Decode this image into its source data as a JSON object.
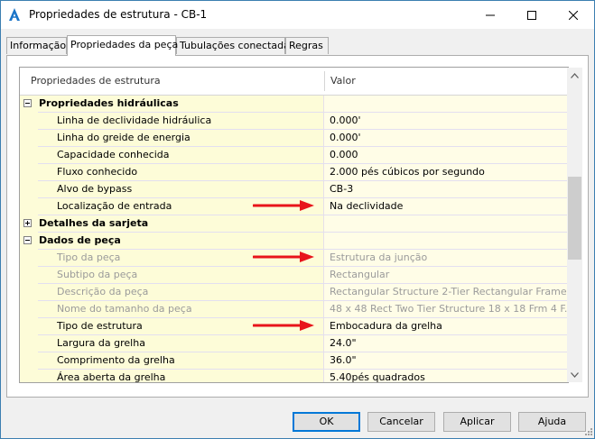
{
  "window": {
    "title": "Propriedades de estrutura - CB-1",
    "controls": {
      "minimize": "minimize",
      "maximize": "maximize",
      "close": "close"
    }
  },
  "tabs": [
    {
      "label": "Informação",
      "active": false
    },
    {
      "label": "Propriedades da peça",
      "active": true
    },
    {
      "label": "Tubulações conectadas",
      "active": false
    },
    {
      "label": "Regras",
      "active": false
    }
  ],
  "grid": {
    "header": {
      "property": "Propriedades de estrutura",
      "value": "Valor"
    },
    "rows": [
      {
        "type": "category",
        "name": "Propriedades hidráulicas",
        "expanded": true
      },
      {
        "type": "prop",
        "name": "Linha de declividade hidráulica",
        "value": "0.000'"
      },
      {
        "type": "prop",
        "name": "Linha do greide de energia",
        "value": "0.000'"
      },
      {
        "type": "prop",
        "name": "Capacidade conhecida",
        "value": "0.000"
      },
      {
        "type": "prop",
        "name": "Fluxo conhecido",
        "value": "2.000 pés cúbicos por segundo"
      },
      {
        "type": "prop",
        "name": "Alvo de bypass",
        "value": "CB-3"
      },
      {
        "type": "prop",
        "name": "Localização de entrada",
        "value": "Na declividade",
        "arrow": true
      },
      {
        "type": "category",
        "name": "Detalhes da sarjeta",
        "expanded": false
      },
      {
        "type": "category",
        "name": "Dados de peça",
        "expanded": true
      },
      {
        "type": "prop",
        "name": "Tipo da peça",
        "value": "Estrutura da junção",
        "dim": true,
        "arrow": true
      },
      {
        "type": "prop",
        "name": "Subtipo da peça",
        "value": "Rectangular",
        "dim": true
      },
      {
        "type": "prop",
        "name": "Descrição da peça",
        "value": "Rectangular Structure 2-Tier Rectangular Frame",
        "dim": true
      },
      {
        "type": "prop",
        "name": "Nome do tamanho da peça",
        "value": "48 x 48 Rect Two Tier Structure 18 x 18 Frm 4 F...",
        "dim": true
      },
      {
        "type": "prop",
        "name": "Tipo de estrutura",
        "value": "Embocadura da grelha",
        "arrow": true
      },
      {
        "type": "prop",
        "name": "Largura da grelha",
        "value": "24.0\""
      },
      {
        "type": "prop",
        "name": "Comprimento da grelha",
        "value": "36.0\""
      },
      {
        "type": "prop",
        "name": "Área aberta da grelha",
        "value": "5.40pés quadrados"
      }
    ]
  },
  "buttons": {
    "ok": "OK",
    "cancel": "Cancelar",
    "apply": "Aplicar",
    "help": "Ajuda"
  },
  "colors": {
    "accent": "#0078d7",
    "arrow": "#e8141b",
    "row_bg": "#fdfcd8"
  }
}
